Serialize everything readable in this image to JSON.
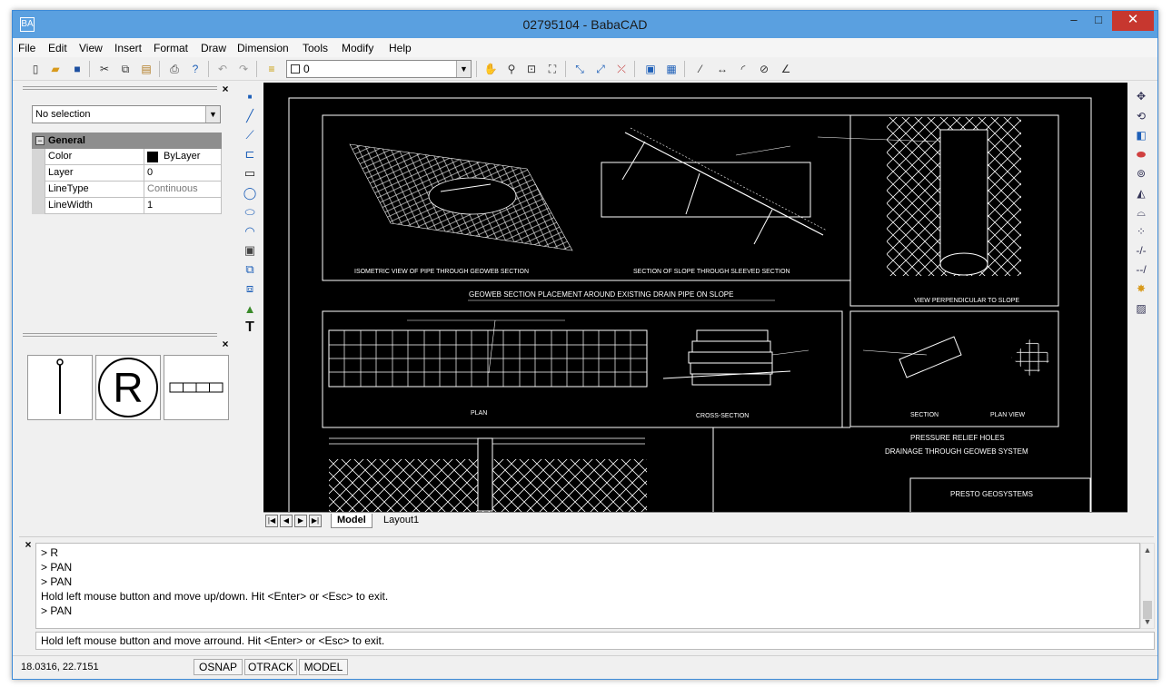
{
  "window": {
    "title": "02795104 - BabaCAD",
    "app_icon": "BA",
    "minimize": "‒",
    "maximize": "□",
    "close": "✕"
  },
  "menu": [
    "File",
    "Edit",
    "View",
    "Insert",
    "Format",
    "Draw",
    "Dimension",
    "Tools",
    "Modify",
    "Help"
  ],
  "toolbar": {
    "layer_value": "0"
  },
  "properties": {
    "selection": "No selection",
    "group": "General",
    "rows": [
      {
        "key": "Color",
        "value": "ByLayer"
      },
      {
        "key": "Layer",
        "value": "0"
      },
      {
        "key": "LineType",
        "value": "Continuous"
      },
      {
        "key": "LineWidth",
        "value": "1"
      }
    ]
  },
  "blocks": {
    "r_label": "R"
  },
  "tabs": [
    "Model",
    "Layout1"
  ],
  "drawing": {
    "labels": [
      "ISOMETRIC VIEW OF PIPE THROUGH GEOWEB SECTION",
      "SECTION OF SLOPE THROUGH SLEEVED SECTION",
      "VIEW PERPENDICULAR TO SLOPE",
      "GEOWEB SECTION PLACEMENT AROUND EXISTING DRAIN PIPE ON SLOPE",
      "PLAN",
      "CROSS-SECTION",
      "SECTION",
      "PLAN VIEW",
      "PRESSURE RELIEF HOLES",
      "DRAINAGE THROUGH GEOWEB SYSTEM",
      "PRESTO GEOSYSTEMS"
    ]
  },
  "command": {
    "history": [
      "> R",
      "> PAN",
      "> PAN",
      "Hold left mouse button and move up/down. Hit <Enter> or <Esc> to exit.",
      "> PAN"
    ],
    "prompt": "Hold left mouse button and move arround. Hit <Enter> or <Esc> to exit."
  },
  "status": {
    "coords": "18.0316, 22.7151",
    "buttons": [
      "OSNAP",
      "OTRACK",
      "MODEL"
    ]
  },
  "colors": {
    "titlebar": "#5aa0e0",
    "close": "#c7372f",
    "canvas": "#000000"
  }
}
